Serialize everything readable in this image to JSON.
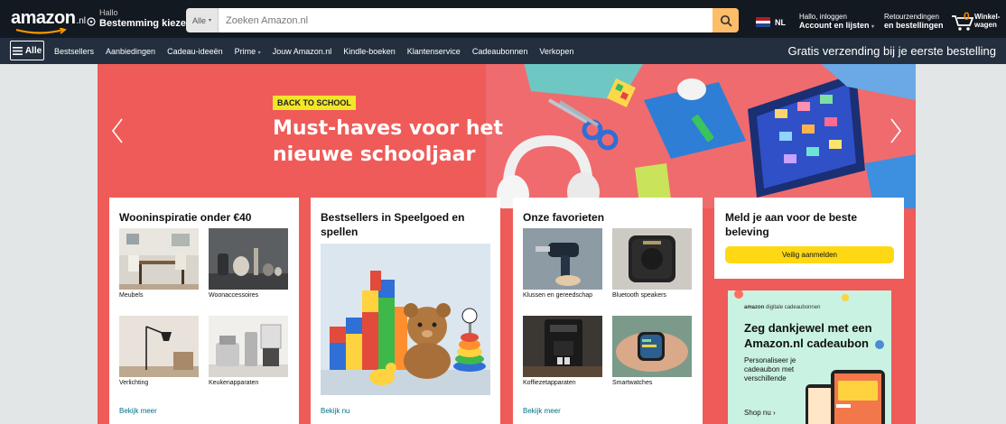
{
  "header": {
    "logo_text": "amazon",
    "logo_tld": ".nl",
    "deliver_line1": "Hallo",
    "deliver_line2": "Bestemming kiezen",
    "search_category": "Alle",
    "search_placeholder": "Zoeken Amazon.nl",
    "language": "NL",
    "account_line1": "Hallo, inloggen",
    "account_line2": "Account en lijsten",
    "returns_line1": "Retourzendingen",
    "returns_line2": "en bestellingen",
    "cart_count": "0",
    "cart_line1": "Winkel-",
    "cart_line2": "wagen",
    "brand_color": "#131921",
    "accent_color": "#febd69"
  },
  "subnav": {
    "all_label": "Alle",
    "links": [
      "Bestsellers",
      "Aanbiedingen",
      "Cadeau-ideeën",
      "Prime",
      "Jouw Amazon.nl",
      "Kindle-boeken",
      "Klantenservice",
      "Cadeaubonnen",
      "Verkopen"
    ],
    "promo": "Gratis verzending bij je eerste bestelling"
  },
  "hero": {
    "badge": "BACK TO SCHOOL",
    "title": "Must-haves voor het nieuwe schooljaar",
    "background_color": "#ef5b58"
  },
  "cards": [
    {
      "title": "Wooninspiratie onder €40",
      "tiles": [
        "Meubels",
        "Woonaccessoires",
        "Verlichting",
        "Keukenapparaten"
      ],
      "link": "Bekijk meer"
    },
    {
      "title": "Bestsellers in Speelgoed en spellen",
      "link": "Bekijk nu"
    },
    {
      "title": "Onze favorieten",
      "tiles": [
        "Klussen en gereedschap",
        "Bluetooth speakers",
        "Koffiezetapparaten",
        "Smartwatches"
      ],
      "link": "Bekijk meer"
    }
  ],
  "signin": {
    "title": "Meld je aan voor de beste beleving",
    "button": "Veilig aanmelden"
  },
  "gift_ad": {
    "brand": "amazon",
    "brand_suffix": "digitale cadeaubonnen",
    "title": "Zeg dankjewel met een Amazon.nl cadeaubon",
    "subtitle": "Personaliseer je cadeaubon met verschillende",
    "cta": "Shop nu ›"
  }
}
